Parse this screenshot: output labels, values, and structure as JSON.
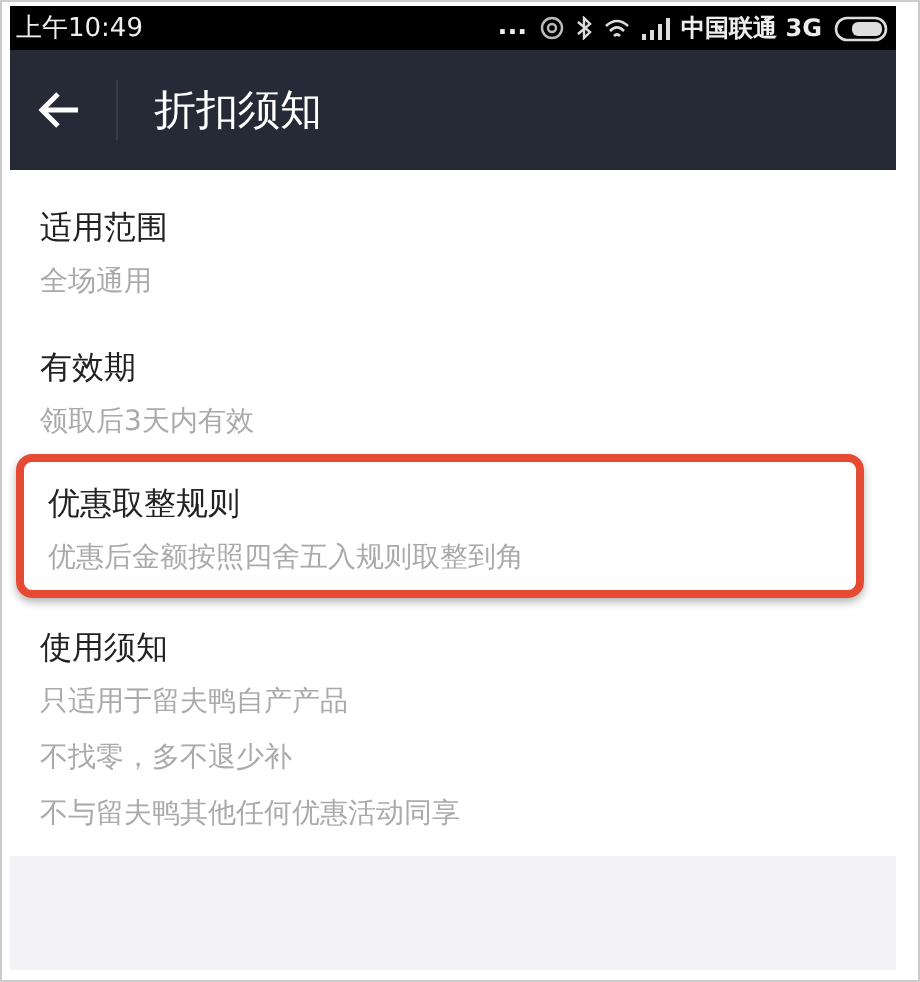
{
  "status_bar": {
    "time": "上午10:49",
    "dots": "...",
    "carrier": "中国联通 3G"
  },
  "header": {
    "title": "折扣须知"
  },
  "sections": [
    {
      "title": "适用范围",
      "lines": [
        "全场通用"
      ],
      "highlighted": false
    },
    {
      "title": "有效期",
      "lines": [
        "领取后3天内有效"
      ],
      "highlighted": false
    },
    {
      "title": "优惠取整规则",
      "lines": [
        "优惠后金额按照四舍五入规则取整到角"
      ],
      "highlighted": true
    },
    {
      "title": "使用须知",
      "lines": [
        "只适用于留夫鸭自产产品",
        "不找零，多不退少补",
        "不与留夫鸭其他任何优惠活动同享"
      ],
      "highlighted": false
    }
  ]
}
